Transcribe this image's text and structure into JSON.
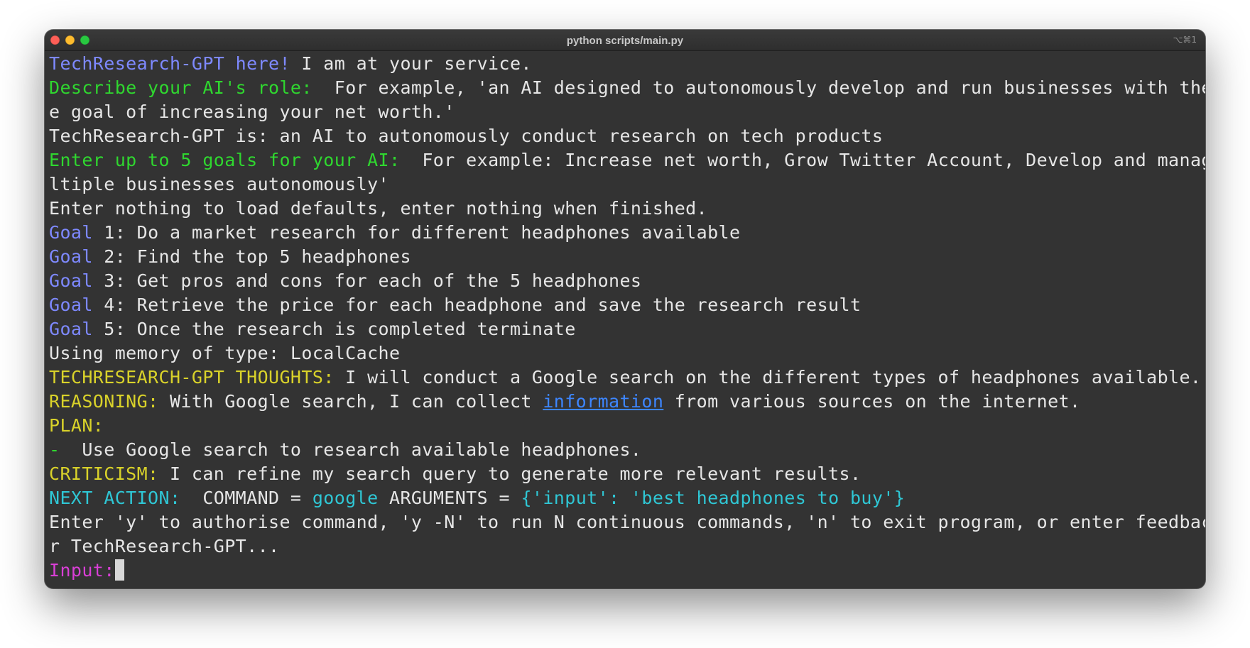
{
  "window": {
    "title": "python scripts/main.py",
    "shortcut": "⌥⌘1"
  },
  "terminal": {
    "intro_name": "TechResearch-GPT here!",
    "intro_text": " I am at your service.",
    "role_prompt_label": "Describe your AI's role:",
    "role_prompt_text_1": "  For example, 'an AI designed to autonomously develop and run businesses with the sol",
    "role_prompt_text_2": "e goal of increasing your net worth.'",
    "role_answer": "TechResearch-GPT is: an AI to autonomously conduct research on tech products",
    "goals_prompt_label": "Enter up to 5 goals for your AI:",
    "goals_prompt_text_1": "  For example: Increase net worth, Grow Twitter Account, Develop and manage mu",
    "goals_prompt_text_2": "ltiple businesses autonomously'",
    "goals_hint": "Enter nothing to load defaults, enter nothing when finished.",
    "goal_label": "Goal",
    "goals": [
      " 1: Do a market research for different headphones available",
      " 2: Find the top 5 headphones",
      " 3: Get pros and cons for each of the 5 headphones",
      " 4: Retrieve the price for each headphone and save the research result",
      " 5: Once the research is completed terminate"
    ],
    "memory_line": "Using memory of type: LocalCache",
    "thoughts_label": "TECHRESEARCH-GPT THOUGHTS:",
    "thoughts_text": " I will conduct a Google search on the different types of headphones available.",
    "reasoning_label": "REASONING:",
    "reasoning_text_1": " With Google search, I can collect ",
    "reasoning_link": "information",
    "reasoning_text_2": " from various sources on the internet.",
    "plan_label": "PLAN:",
    "plan_bullet": "-",
    "plan_item": "  Use Google search to research available headphones.",
    "criticism_label": "CRITICISM:",
    "criticism_text": " I can refine my search query to generate more relevant results.",
    "next_action_label": "NEXT ACTION:",
    "command_label": "  COMMAND = ",
    "command_value": "google",
    "arguments_label": " ARGUMENTS = ",
    "arguments_value": "{'input': 'best headphones to buy'}",
    "authorise_text_1": "Enter 'y' to authorise command, 'y -N' to run N continuous commands, 'n' to exit program, or enter feedback fo",
    "authorise_text_2": "r TechResearch-GPT...",
    "input_label": "Input:"
  },
  "colors": {
    "background": "#333333",
    "text": "#e6e6e6",
    "blue": "#7e89ff",
    "green": "#2fd72f",
    "yellow": "#d9d22a",
    "cyan": "#2fc7d5",
    "magenta": "#d93fd6",
    "link": "#3d86ff"
  }
}
